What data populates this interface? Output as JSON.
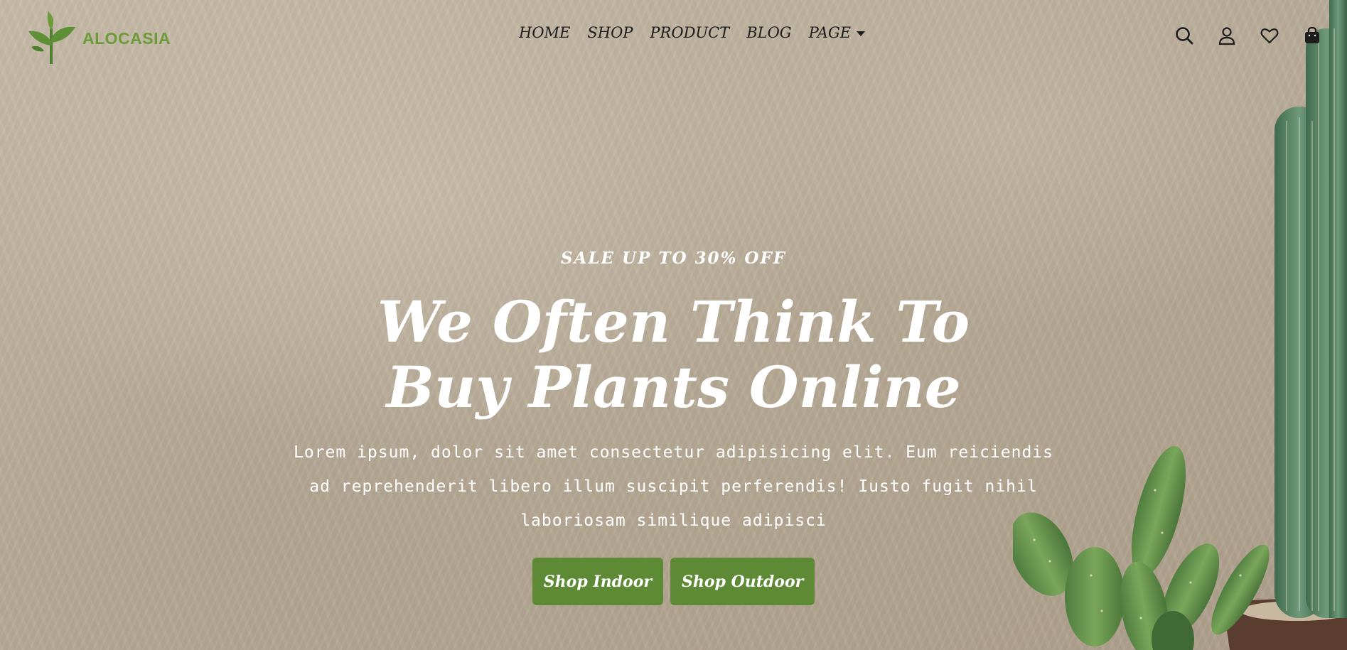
{
  "brand": {
    "name": "ALOCASIA",
    "logo_icon": "leaf-sprout-icon",
    "color": "#6d9a3a"
  },
  "nav": {
    "items": [
      {
        "label": "HOME"
      },
      {
        "label": "SHOP"
      },
      {
        "label": "PRODUCT"
      },
      {
        "label": "BLOG"
      },
      {
        "label": "PAGE",
        "dropdown": true
      }
    ]
  },
  "actions": [
    "search-icon",
    "user-icon",
    "heart-icon",
    "shopping-bag-icon"
  ],
  "hero": {
    "eyebrow": "SALE UP TO 30% OFF",
    "headline_line1": "We Often Think To",
    "headline_line2": "Buy Plants Online",
    "description": "Lorem ipsum, dolor sit amet consectetur adipisicing elit. Eum reiciendis ad reprehenderit libero illum suscipit perferendis! Iusto fugit nihil laboriosam similique adipisci",
    "primary_button": "Shop Indoor",
    "secondary_button": "Shop Outdoor"
  },
  "colors": {
    "accent": "#5f8a35",
    "text_light": "#ffffff",
    "nav_text": "#1d1d1d"
  }
}
